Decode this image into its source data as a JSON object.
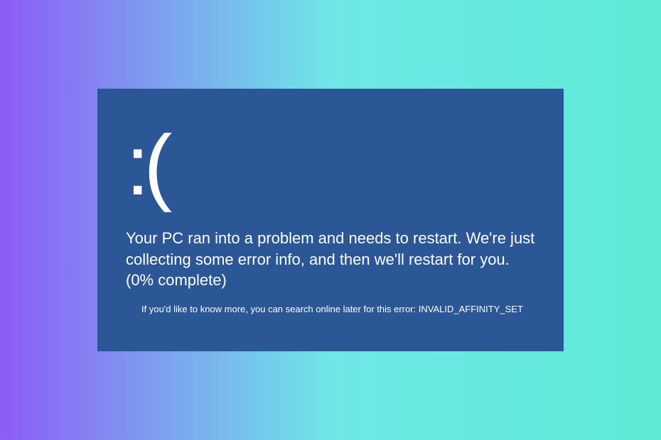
{
  "bsod": {
    "frown": ":(",
    "message": "Your PC ran into a problem and needs to restart. We're just collecting some error info, and then we'll restart for you. (0% complete)",
    "sub_text": "If you'd like to know more, you can search online later for this error: ",
    "error_code": "INVALID_AFFINITY_SET",
    "percent_complete": 0,
    "colors": {
      "panel_bg": "#2b5797",
      "text": "#ffffff",
      "gradient_left": "#8b5cf6",
      "gradient_right": "#5eead4"
    }
  }
}
